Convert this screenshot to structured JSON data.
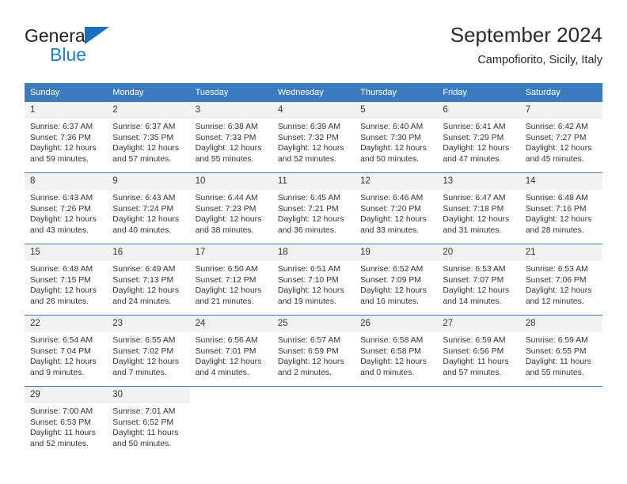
{
  "brand": {
    "name_top": "General",
    "name_bottom": "Blue",
    "triangle_color": "#1b6ec2",
    "blue_text_color": "#1b7fd4"
  },
  "header": {
    "title": "September 2024",
    "subtitle": "Campofiorito, Sicily, Italy"
  },
  "theme": {
    "header_row_bg": "#3a7cbe",
    "header_row_text": "#ffffff",
    "daynum_bg": "#f2f2f2",
    "cell_border": "#3a7cbe",
    "body_text": "#333333"
  },
  "weekday_headers": [
    "Sunday",
    "Monday",
    "Tuesday",
    "Wednesday",
    "Thursday",
    "Friday",
    "Saturday"
  ],
  "labels": {
    "sunrise_prefix": "Sunrise:",
    "sunset_prefix": "Sunset:",
    "daylight_prefix": "Daylight:"
  },
  "weeks": [
    [
      {
        "day": "1",
        "sunrise": "Sunrise: 6:37 AM",
        "sunset": "Sunset: 7:36 PM",
        "daylight_1": "Daylight: 12 hours",
        "daylight_2": "and 59 minutes."
      },
      {
        "day": "2",
        "sunrise": "Sunrise: 6:37 AM",
        "sunset": "Sunset: 7:35 PM",
        "daylight_1": "Daylight: 12 hours",
        "daylight_2": "and 57 minutes."
      },
      {
        "day": "3",
        "sunrise": "Sunrise: 6:38 AM",
        "sunset": "Sunset: 7:33 PM",
        "daylight_1": "Daylight: 12 hours",
        "daylight_2": "and 55 minutes."
      },
      {
        "day": "4",
        "sunrise": "Sunrise: 6:39 AM",
        "sunset": "Sunset: 7:32 PM",
        "daylight_1": "Daylight: 12 hours",
        "daylight_2": "and 52 minutes."
      },
      {
        "day": "5",
        "sunrise": "Sunrise: 6:40 AM",
        "sunset": "Sunset: 7:30 PM",
        "daylight_1": "Daylight: 12 hours",
        "daylight_2": "and 50 minutes."
      },
      {
        "day": "6",
        "sunrise": "Sunrise: 6:41 AM",
        "sunset": "Sunset: 7:29 PM",
        "daylight_1": "Daylight: 12 hours",
        "daylight_2": "and 47 minutes."
      },
      {
        "day": "7",
        "sunrise": "Sunrise: 6:42 AM",
        "sunset": "Sunset: 7:27 PM",
        "daylight_1": "Daylight: 12 hours",
        "daylight_2": "and 45 minutes."
      }
    ],
    [
      {
        "day": "8",
        "sunrise": "Sunrise: 6:43 AM",
        "sunset": "Sunset: 7:26 PM",
        "daylight_1": "Daylight: 12 hours",
        "daylight_2": "and 43 minutes."
      },
      {
        "day": "9",
        "sunrise": "Sunrise: 6:43 AM",
        "sunset": "Sunset: 7:24 PM",
        "daylight_1": "Daylight: 12 hours",
        "daylight_2": "and 40 minutes."
      },
      {
        "day": "10",
        "sunrise": "Sunrise: 6:44 AM",
        "sunset": "Sunset: 7:23 PM",
        "daylight_1": "Daylight: 12 hours",
        "daylight_2": "and 38 minutes."
      },
      {
        "day": "11",
        "sunrise": "Sunrise: 6:45 AM",
        "sunset": "Sunset: 7:21 PM",
        "daylight_1": "Daylight: 12 hours",
        "daylight_2": "and 36 minutes."
      },
      {
        "day": "12",
        "sunrise": "Sunrise: 6:46 AM",
        "sunset": "Sunset: 7:20 PM",
        "daylight_1": "Daylight: 12 hours",
        "daylight_2": "and 33 minutes."
      },
      {
        "day": "13",
        "sunrise": "Sunrise: 6:47 AM",
        "sunset": "Sunset: 7:18 PM",
        "daylight_1": "Daylight: 12 hours",
        "daylight_2": "and 31 minutes."
      },
      {
        "day": "14",
        "sunrise": "Sunrise: 6:48 AM",
        "sunset": "Sunset: 7:16 PM",
        "daylight_1": "Daylight: 12 hours",
        "daylight_2": "and 28 minutes."
      }
    ],
    [
      {
        "day": "15",
        "sunrise": "Sunrise: 6:48 AM",
        "sunset": "Sunset: 7:15 PM",
        "daylight_1": "Daylight: 12 hours",
        "daylight_2": "and 26 minutes."
      },
      {
        "day": "16",
        "sunrise": "Sunrise: 6:49 AM",
        "sunset": "Sunset: 7:13 PM",
        "daylight_1": "Daylight: 12 hours",
        "daylight_2": "and 24 minutes."
      },
      {
        "day": "17",
        "sunrise": "Sunrise: 6:50 AM",
        "sunset": "Sunset: 7:12 PM",
        "daylight_1": "Daylight: 12 hours",
        "daylight_2": "and 21 minutes."
      },
      {
        "day": "18",
        "sunrise": "Sunrise: 6:51 AM",
        "sunset": "Sunset: 7:10 PM",
        "daylight_1": "Daylight: 12 hours",
        "daylight_2": "and 19 minutes."
      },
      {
        "day": "19",
        "sunrise": "Sunrise: 6:52 AM",
        "sunset": "Sunset: 7:09 PM",
        "daylight_1": "Daylight: 12 hours",
        "daylight_2": "and 16 minutes."
      },
      {
        "day": "20",
        "sunrise": "Sunrise: 6:53 AM",
        "sunset": "Sunset: 7:07 PM",
        "daylight_1": "Daylight: 12 hours",
        "daylight_2": "and 14 minutes."
      },
      {
        "day": "21",
        "sunrise": "Sunrise: 6:53 AM",
        "sunset": "Sunset: 7:06 PM",
        "daylight_1": "Daylight: 12 hours",
        "daylight_2": "and 12 minutes."
      }
    ],
    [
      {
        "day": "22",
        "sunrise": "Sunrise: 6:54 AM",
        "sunset": "Sunset: 7:04 PM",
        "daylight_1": "Daylight: 12 hours",
        "daylight_2": "and 9 minutes."
      },
      {
        "day": "23",
        "sunrise": "Sunrise: 6:55 AM",
        "sunset": "Sunset: 7:02 PM",
        "daylight_1": "Daylight: 12 hours",
        "daylight_2": "and 7 minutes."
      },
      {
        "day": "24",
        "sunrise": "Sunrise: 6:56 AM",
        "sunset": "Sunset: 7:01 PM",
        "daylight_1": "Daylight: 12 hours",
        "daylight_2": "and 4 minutes."
      },
      {
        "day": "25",
        "sunrise": "Sunrise: 6:57 AM",
        "sunset": "Sunset: 6:59 PM",
        "daylight_1": "Daylight: 12 hours",
        "daylight_2": "and 2 minutes."
      },
      {
        "day": "26",
        "sunrise": "Sunrise: 6:58 AM",
        "sunset": "Sunset: 6:58 PM",
        "daylight_1": "Daylight: 12 hours",
        "daylight_2": "and 0 minutes."
      },
      {
        "day": "27",
        "sunrise": "Sunrise: 6:59 AM",
        "sunset": "Sunset: 6:56 PM",
        "daylight_1": "Daylight: 11 hours",
        "daylight_2": "and 57 minutes."
      },
      {
        "day": "28",
        "sunrise": "Sunrise: 6:59 AM",
        "sunset": "Sunset: 6:55 PM",
        "daylight_1": "Daylight: 11 hours",
        "daylight_2": "and 55 minutes."
      }
    ],
    [
      {
        "day": "29",
        "sunrise": "Sunrise: 7:00 AM",
        "sunset": "Sunset: 6:53 PM",
        "daylight_1": "Daylight: 11 hours",
        "daylight_2": "and 52 minutes."
      },
      {
        "day": "30",
        "sunrise": "Sunrise: 7:01 AM",
        "sunset": "Sunset: 6:52 PM",
        "daylight_1": "Daylight: 11 hours",
        "daylight_2": "and 50 minutes."
      },
      {
        "day": "",
        "sunrise": "",
        "sunset": "",
        "daylight_1": "",
        "daylight_2": ""
      },
      {
        "day": "",
        "sunrise": "",
        "sunset": "",
        "daylight_1": "",
        "daylight_2": ""
      },
      {
        "day": "",
        "sunrise": "",
        "sunset": "",
        "daylight_1": "",
        "daylight_2": ""
      },
      {
        "day": "",
        "sunrise": "",
        "sunset": "",
        "daylight_1": "",
        "daylight_2": ""
      },
      {
        "day": "",
        "sunrise": "",
        "sunset": "",
        "daylight_1": "",
        "daylight_2": ""
      }
    ]
  ]
}
